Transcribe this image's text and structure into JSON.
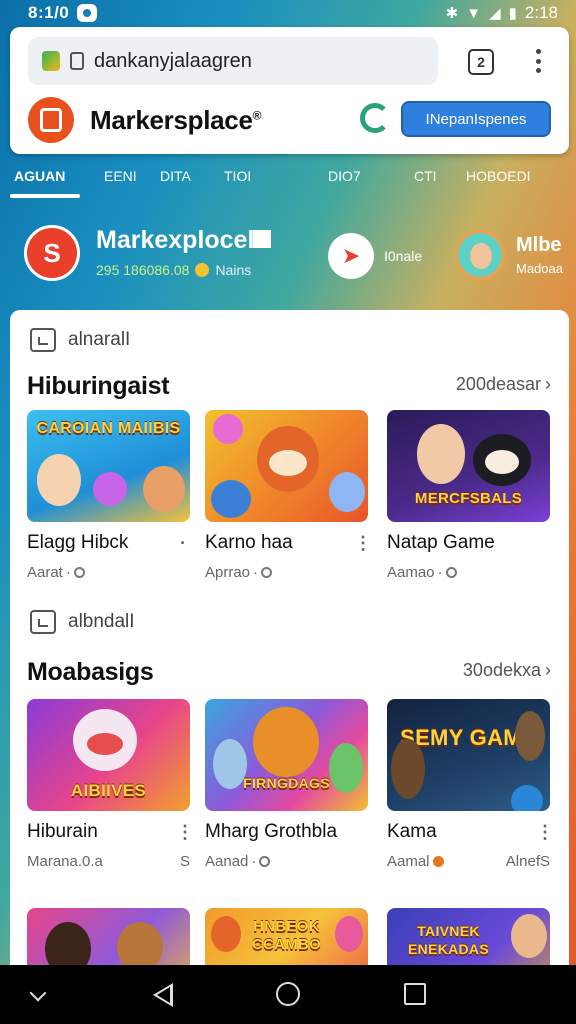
{
  "status_bar": {
    "time_left": "8:1/0",
    "time_right": "2:18",
    "icons": [
      "notification-icon",
      "do-not-disturb-icon",
      "wifi-icon",
      "signal-icon",
      "battery-icon"
    ]
  },
  "browser": {
    "url": "dankanyjalaagren",
    "site_title": "Markersplace",
    "site_title_mark": "®",
    "cta_label": "INepanIspenes",
    "tab_count": "2"
  },
  "nav_tabs": [
    {
      "label": "AGUAN",
      "active": true
    },
    {
      "label": "EENI",
      "active": false
    },
    {
      "label": "DITA",
      "active": false
    },
    {
      "label": "TIOI",
      "active": false
    },
    {
      "label": "DIO7",
      "active": false
    },
    {
      "label": "CTI",
      "active": false
    },
    {
      "label": "HOBOEDI",
      "active": false
    }
  ],
  "hero": {
    "title": "Markexplocel",
    "stat": "295 186086.08",
    "stat_suffix": "Nains",
    "online_label": "I0nale",
    "user_name": "Mlbe",
    "user_sub": "Madoaa"
  },
  "sections": [
    {
      "tag": "alnaralI",
      "title": "Hiburingaist",
      "see_all": "200deasar",
      "cards": [
        {
          "name": "Elagg Hibck",
          "meta": "Aarat",
          "meta_right": "",
          "thumb_text": "CAROIAN MAIIBIS",
          "theme": [
            "#3cc0ef",
            "#f5c13a"
          ]
        },
        {
          "name": "Karno haa",
          "meta": "Aprrao",
          "meta_right": "",
          "thumb_text": "",
          "theme": [
            "#f2c12f",
            "#e8552a"
          ]
        },
        {
          "name": "Natap Game",
          "meta": "Aamao",
          "meta_right": "",
          "thumb_text": "MERCFSBALS",
          "theme": [
            "#2a1b58",
            "#7b3fd6"
          ]
        }
      ]
    },
    {
      "tag": "albndalI",
      "title": "Moabasigs",
      "see_all": "30odekxa",
      "cards": [
        {
          "name": "Hiburain",
          "meta": "Marana.0.a",
          "meta_right": "S",
          "thumb_text": "AIBIIVES",
          "theme": [
            "#8b3ad8",
            "#f2a12a"
          ]
        },
        {
          "name": "Mharg Grothbla",
          "meta": "Aanad",
          "meta_right": "",
          "thumb_text": "FIRNGDAGS",
          "theme": [
            "#3aa6e0",
            "#e44aa0"
          ]
        },
        {
          "name": "Kama",
          "meta": "Aamal",
          "meta_right": "AlnefS",
          "thumb_text": "SEMY GAMS",
          "theme": [
            "#12233f",
            "#2e5c88"
          ]
        }
      ]
    },
    {
      "tag": "",
      "title": "",
      "see_all": "",
      "cards": [
        {
          "name": "",
          "meta": "",
          "meta_right": "",
          "thumb_text": "",
          "theme": [
            "#e8458a",
            "#f7c030"
          ]
        },
        {
          "name": "",
          "meta": "",
          "meta_right": "",
          "thumb_text": "HNBEOK CCAMBO",
          "theme": [
            "#f29a2a",
            "#e94a4a"
          ]
        },
        {
          "name": "",
          "meta": "",
          "meta_right": "",
          "thumb_text": "TAIVNEK ENEKADAS",
          "theme": [
            "#3a3fb8",
            "#e6a62c"
          ]
        }
      ]
    }
  ],
  "colors": {
    "accent": "#2f7fde",
    "brand": "#e8501f",
    "panel": "#ffffff"
  }
}
